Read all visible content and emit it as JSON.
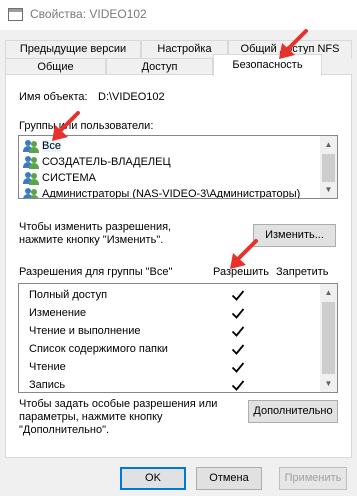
{
  "window": {
    "title": "Свойства: VIDEO102"
  },
  "tabs_back": [
    {
      "label": "Предыдущие версии"
    },
    {
      "label": "Настройка"
    },
    {
      "label": "Общий доступ NFS"
    }
  ],
  "tabs_front": [
    {
      "label": "Общие"
    },
    {
      "label": "Доступ"
    },
    {
      "label": "Безопасность"
    }
  ],
  "object": {
    "label": "Имя объекта:",
    "value": "D:\\VIDEO102"
  },
  "groups": {
    "label": "Группы или пользователи:",
    "items": [
      {
        "label": "Все"
      },
      {
        "label": "СОЗДАТЕЛЬ-ВЛАДЕЛЕЦ"
      },
      {
        "label": "СИСТЕМА"
      },
      {
        "label": "Администраторы (NAS-VIDEO-3\\Администраторы)"
      }
    ]
  },
  "change": {
    "hint_line1": "Чтобы изменить разрешения,",
    "hint_line2": "нажмите кнопку \"Изменить\".",
    "button": "Изменить..."
  },
  "permissions": {
    "group_label": "Разрешения для группы \"Все\"",
    "allow_header": "Разрешить",
    "deny_header": "Запретить",
    "items": [
      {
        "name": "Полный доступ",
        "allow": true,
        "deny": false
      },
      {
        "name": "Изменение",
        "allow": true,
        "deny": false
      },
      {
        "name": "Чтение и выполнение",
        "allow": true,
        "deny": false
      },
      {
        "name": "Список содержимого папки",
        "allow": true,
        "deny": false
      },
      {
        "name": "Чтение",
        "allow": true,
        "deny": false
      },
      {
        "name": "Запись",
        "allow": true,
        "deny": false
      }
    ]
  },
  "advanced": {
    "hint_line1": "Чтобы задать особые разрешения или",
    "hint_line2": "параметры, нажмите кнопку",
    "hint_line3": "\"Дополнительно\".",
    "button": "Дополнительно"
  },
  "footer": {
    "ok": "OK",
    "cancel": "Отмена",
    "apply": "Применить"
  },
  "colors": {
    "accent": "#0078d7",
    "annotation_arrow": "#e8312a"
  }
}
